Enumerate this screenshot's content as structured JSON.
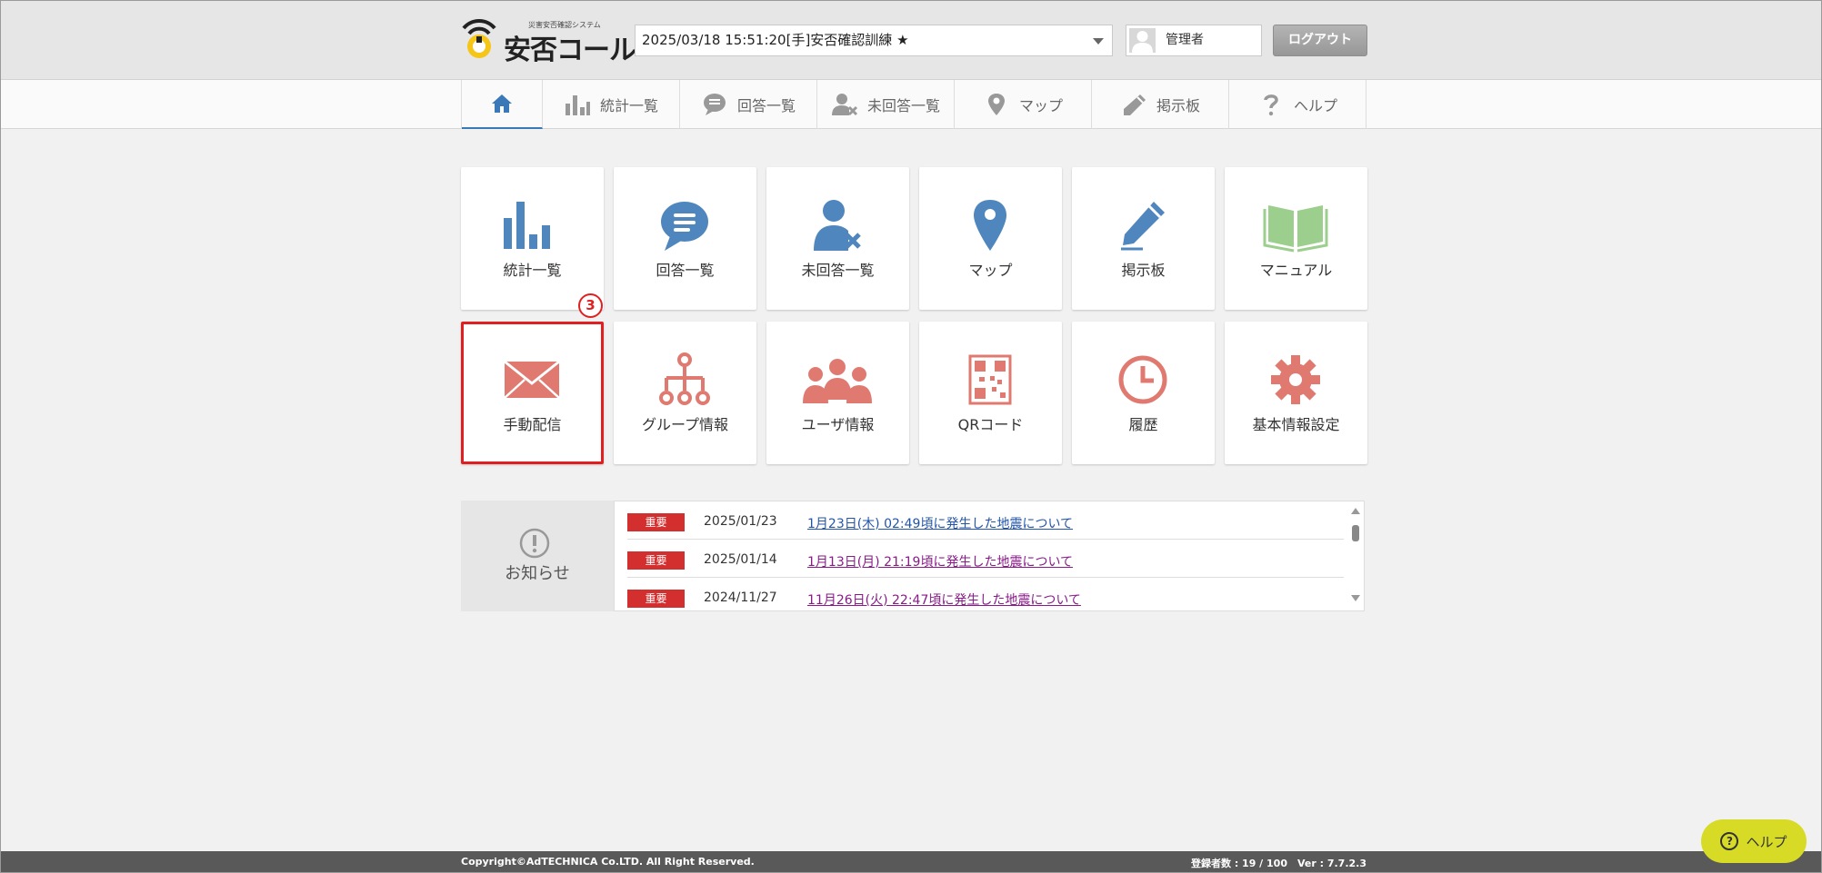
{
  "header": {
    "logo_sub": "災害安否確認システム",
    "logo_main": "安否コール",
    "session_value": "2025/03/18 15:51:20[手]安否確認訓練 ★",
    "user_name": "管理者",
    "logout_label": "ログアウト"
  },
  "nav": {
    "tabs": [
      {
        "label": "統計一覧",
        "icon": "bar-chart-icon"
      },
      {
        "label": "回答一覧",
        "icon": "chat-bubble-icon"
      },
      {
        "label": "未回答一覧",
        "icon": "user-x-icon"
      },
      {
        "label": "マップ",
        "icon": "map-pin-icon"
      },
      {
        "label": "掲示板",
        "icon": "pencil-icon"
      },
      {
        "label": "ヘルプ",
        "icon": "question-icon"
      }
    ]
  },
  "tiles": [
    {
      "label": "統計一覧",
      "icon": "bar-chart-icon"
    },
    {
      "label": "回答一覧",
      "icon": "chat-bubble-icon"
    },
    {
      "label": "未回答一覧",
      "icon": "user-x-icon"
    },
    {
      "label": "マップ",
      "icon": "map-pin-icon"
    },
    {
      "label": "掲示板",
      "icon": "pencil-icon"
    },
    {
      "label": "マニュアル",
      "icon": "book-icon"
    },
    {
      "label": "手動配信",
      "icon": "envelope-icon"
    },
    {
      "label": "グループ情報",
      "icon": "org-chart-icon"
    },
    {
      "label": "ユーザ情報",
      "icon": "users-icon"
    },
    {
      "label": "QRコード",
      "icon": "qr-code-icon"
    },
    {
      "label": "履歴",
      "icon": "clock-icon"
    },
    {
      "label": "基本情報設定",
      "icon": "gear-icon"
    }
  ],
  "step_badge": "3",
  "news": {
    "title": "お知らせ",
    "items": [
      {
        "badge": "重要",
        "date": "2025/01/23",
        "title": "1月23日(木) 02:49頃に発生した地震について"
      },
      {
        "badge": "重要",
        "date": "2025/01/14",
        "title": "1月13日(月) 21:19頃に発生した地震について"
      },
      {
        "badge": "重要",
        "date": "2024/11/27",
        "title": "11月26日(火) 22:47頃に発生した地震について"
      }
    ]
  },
  "footer": {
    "copyright": "Copyright©AdTECHNICA Co.LTD. All Right Reserved.",
    "stats": "登録者数 : 19 / 100　Ver : 7.7.2.3"
  },
  "help_button": {
    "label": "ヘルプ"
  },
  "colors": {
    "accent_blue": "#4e86bd",
    "accent_red": "#e07a70",
    "accent_green": "#9ccf8e",
    "important_badge": "#d32f2f",
    "help_float": "#d7db26"
  }
}
